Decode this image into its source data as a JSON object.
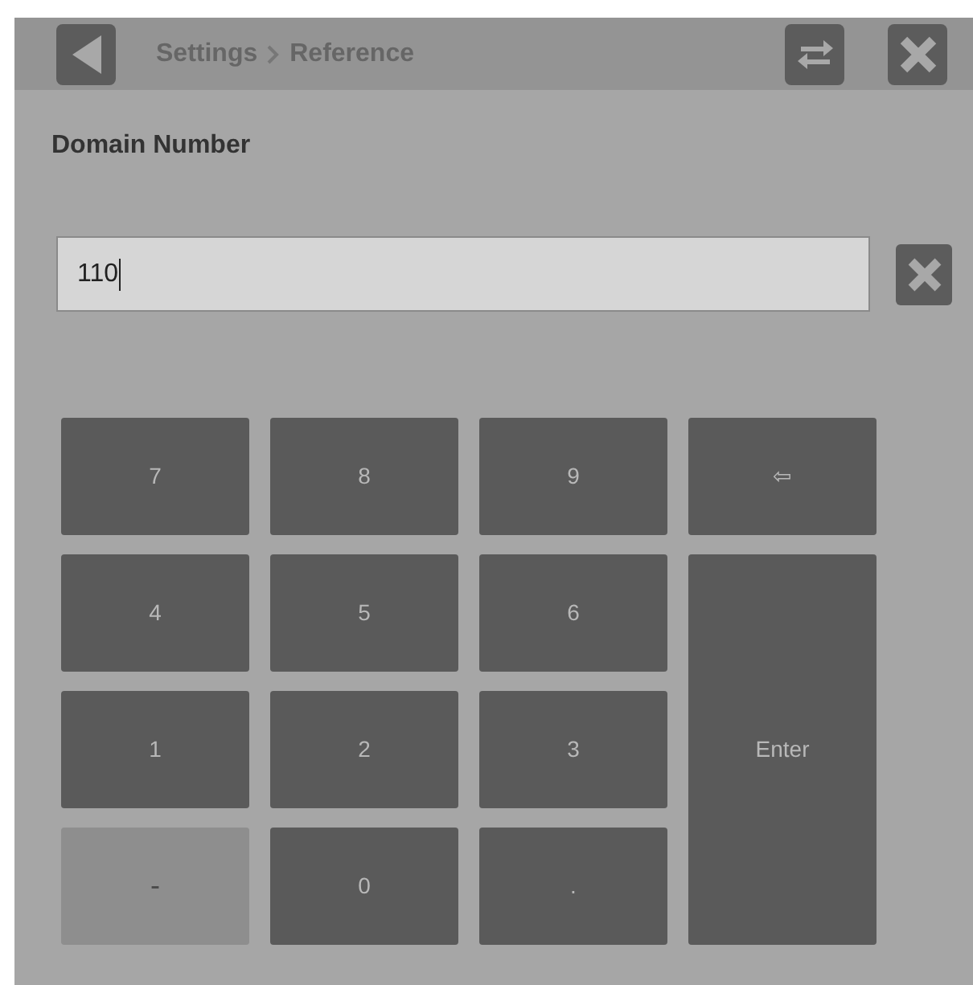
{
  "header": {
    "breadcrumb": [
      {
        "label": "Settings"
      },
      {
        "label": "Reference"
      }
    ]
  },
  "dialog": {
    "title": "Domain Number",
    "value": "110"
  },
  "keypad": [
    {
      "label": "7",
      "kind": "key",
      "disabled": false
    },
    {
      "label": "8",
      "kind": "key",
      "disabled": false
    },
    {
      "label": "9",
      "kind": "key",
      "disabled": false
    },
    {
      "label": "⇦",
      "kind": "key",
      "disabled": false
    },
    {
      "label": "4",
      "kind": "key",
      "disabled": false
    },
    {
      "label": "5",
      "kind": "key",
      "disabled": false
    },
    {
      "label": "6",
      "kind": "key",
      "disabled": false
    },
    {
      "label": "1",
      "kind": "key",
      "disabled": false
    },
    {
      "label": "2",
      "kind": "key",
      "disabled": false
    },
    {
      "label": "3",
      "kind": "key",
      "disabled": false
    },
    {
      "label": "Enter",
      "kind": "enter",
      "disabled": false
    },
    {
      "label": "-",
      "kind": "key",
      "disabled": true
    },
    {
      "label": "0",
      "kind": "key",
      "disabled": false
    },
    {
      "label": ".",
      "kind": "key",
      "disabled": false
    }
  ]
}
